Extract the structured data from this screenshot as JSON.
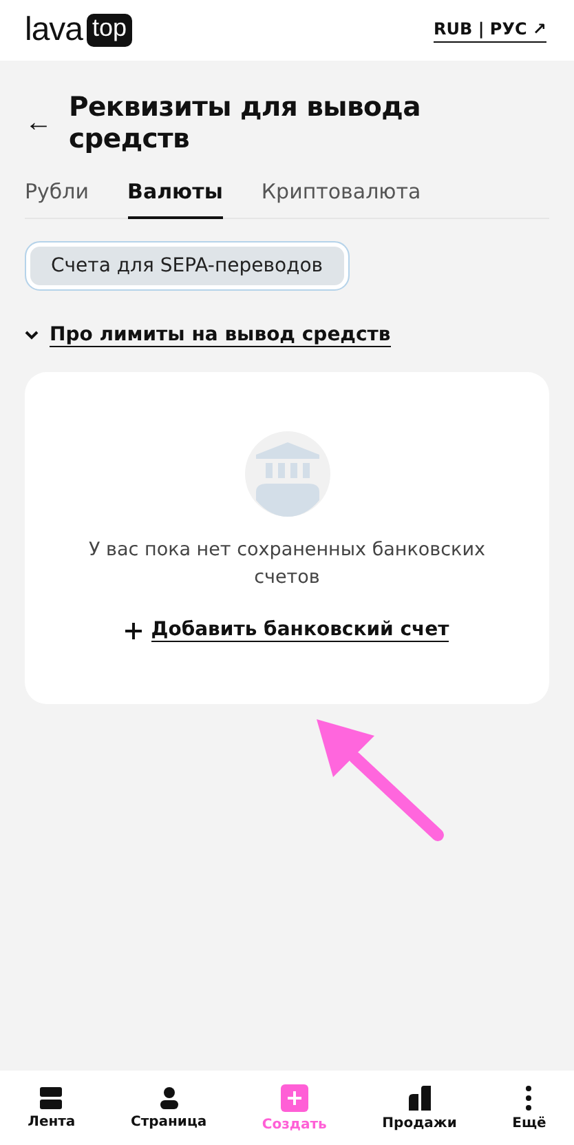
{
  "header": {
    "logo_word": "lava",
    "logo_badge": "top",
    "locale_link": "RUB | РУС ↗"
  },
  "page": {
    "back": "←",
    "title": "Реквизиты для вывода средств"
  },
  "tabs": [
    {
      "label": "Рубли",
      "selected": false
    },
    {
      "label": "Валюты",
      "selected": true
    },
    {
      "label": "Криптовалюта",
      "selected": false
    }
  ],
  "chips": [
    {
      "label": "Счета для SEPA-переводов",
      "selected": true
    }
  ],
  "limits_link": {
    "label": "Про лимиты на вывод средств",
    "expanded": false
  },
  "empty_card": {
    "message": "У вас пока нет сохраненных банковских счетов",
    "add_link": "Добавить банковский счет"
  },
  "bottom_nav": [
    {
      "kind": "feed",
      "label": "Лента",
      "selected": false
    },
    {
      "kind": "profile",
      "label": "Страница",
      "selected": false
    },
    {
      "kind": "create",
      "label": "Создать",
      "selected": true
    },
    {
      "kind": "sales",
      "label": "Продажи",
      "selected": false
    },
    {
      "kind": "more",
      "label": "Ещё",
      "selected": false
    }
  ]
}
